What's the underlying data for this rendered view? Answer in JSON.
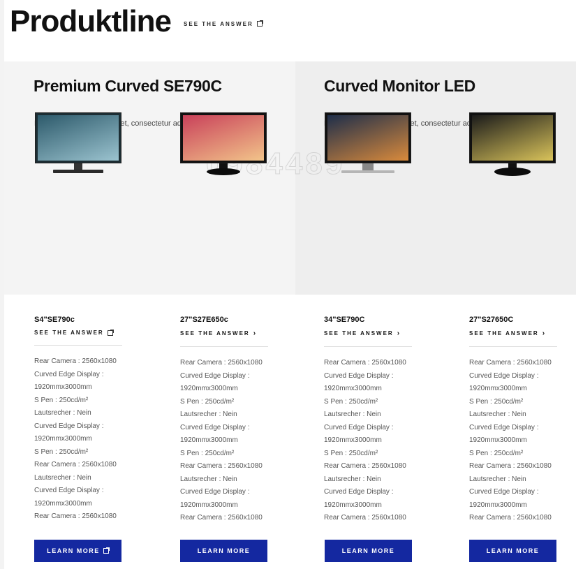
{
  "header": {
    "title": "Produktline",
    "link_label": "SEE THE ANSWER"
  },
  "watermark": "0984489",
  "hero": [
    {
      "title": "Premium Curved SE790C",
      "description": "Lorem ipsum dolor sit amet, consectetur adipisficing"
    },
    {
      "title": "Curved Monitor LED",
      "description": "Lorem ipsum dolor sit amet, consectetur adipisficing"
    }
  ],
  "products": [
    {
      "name": "S4\"SE790c",
      "link_label": "SEE THE ANSWER",
      "link_icon": "external-link-icon",
      "button_label": "LEARN MORE",
      "button_icon": "external-link-icon",
      "screen_colors": [
        "#2d5a6b",
        "#9bc3cf"
      ],
      "specs": [
        "Rear Camera : 2560x1080",
        "Curved Edge Display :",
        "1920mmx3000mm",
        "S Pen : 250cd/m²",
        "Lautsrecher : Nein",
        "Curved Edge Display :",
        "1920mmx3000mm",
        "S Pen : 250cd/m²",
        "Rear Camera : 2560x1080",
        "Lautsrecher : Nein",
        "Curved Edge Display :",
        "1920mmx3000mm",
        "Rear Camera : 2560x1080"
      ]
    },
    {
      "name": "27\"S27E650c",
      "link_label": "SEE THE ANSWER",
      "link_icon": "chevron-right-icon",
      "button_label": "LEARN MORE",
      "button_icon": "",
      "screen_colors": [
        "#c9415a",
        "#f2c48a"
      ],
      "specs": [
        "Rear Camera : 2560x1080",
        "Curved Edge Display :",
        "1920mmx3000mm",
        "S Pen : 250cd/m²",
        "Lautsrecher : Nein",
        "Curved Edge Display :",
        "1920mmx3000mm",
        "S Pen : 250cd/m²",
        "Rear Camera : 2560x1080",
        "Lautsrecher : Nein",
        "Curved Edge Display :",
        "1920mmx3000mm",
        "Rear Camera : 2560x1080"
      ]
    },
    {
      "name": "34\"SE790C",
      "link_label": "SEE THE ANSWER",
      "link_icon": "chevron-right-icon",
      "button_label": "LEARN MORE",
      "button_icon": "",
      "screen_colors": [
        "#1e2e4a",
        "#d98a3c"
      ],
      "specs": [
        "Rear Camera : 2560x1080",
        "Curved Edge Display :",
        "1920mmx3000mm",
        "S Pen : 250cd/m²",
        "Lautsrecher : Nein",
        "Curved Edge Display :",
        "1920mmx3000mm",
        "S Pen : 250cd/m²",
        "Rear Camera : 2560x1080",
        "Lautsrecher : Nein",
        "Curved Edge Display :",
        "1920mmx3000mm",
        "Rear Camera : 2560x1080"
      ]
    },
    {
      "name": "27\"S27650C",
      "link_label": "SEE THE ANSWER",
      "link_icon": "chevron-right-icon",
      "button_label": "LEARN MORE",
      "button_icon": "",
      "screen_colors": [
        "#1b1b1b",
        "#d9c35a"
      ],
      "specs": [
        "Rear Camera : 2560x1080",
        "Curved Edge Display :",
        "1920mmx3000mm",
        "S Pen : 250cd/m²",
        "Lautsrecher : Nein",
        "Curved Edge Display :",
        "1920mmx3000mm",
        "S Pen : 250cd/m²",
        "Rear Camera : 2560x1080",
        "Lautsrecher : Nein",
        "Curved Edge Display :",
        "1920mmx3000mm",
        "Rear Camera : 2560x1080"
      ]
    }
  ],
  "colors": {
    "button": "#1428a0",
    "hero_left": "#f4f4f4",
    "hero_right": "#eeeeee"
  }
}
